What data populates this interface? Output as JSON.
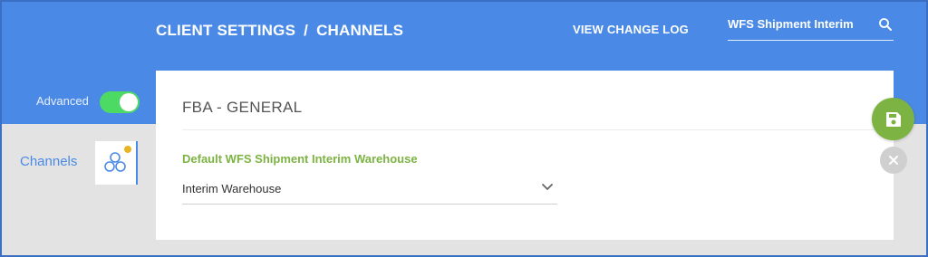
{
  "header": {
    "breadcrumb": [
      "CLIENT SETTINGS",
      "/",
      "CHANNELS"
    ],
    "change_log_label": "VIEW CHANGE LOG",
    "search": {
      "value": "WFS Shipment Interim",
      "icon": "search-icon"
    }
  },
  "sidebar": {
    "advanced_label": "Advanced",
    "advanced_enabled": true,
    "channels_label": "Channels",
    "channels_icon": "channels-icon"
  },
  "card": {
    "title": "FBA - GENERAL",
    "field": {
      "label": "Default WFS Shipment Interim Warehouse",
      "value": "Interim Warehouse",
      "icon": "chevron-down-icon"
    }
  },
  "actions": {
    "save_icon": "save-icon",
    "cancel_icon": "close-icon"
  },
  "colors": {
    "header": "#4a8ae6",
    "toggle_on": "#4cd964",
    "save_button": "#7cb342",
    "field_label": "#7cb342",
    "cancel_button": "#cfcfcf",
    "badge_dot": "#e8b423"
  }
}
